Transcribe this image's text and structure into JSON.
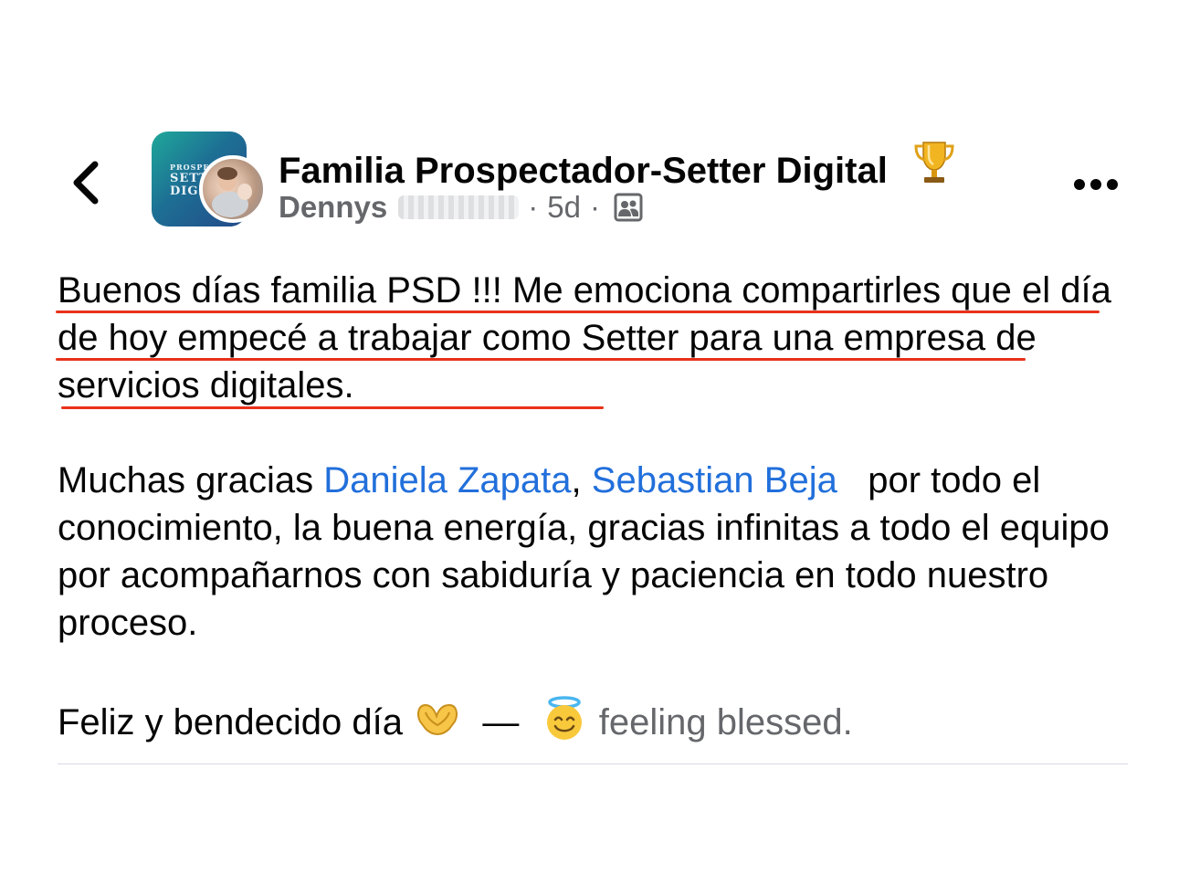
{
  "header": {
    "group_name": "Familia Prospectador-Setter Digital",
    "author_first_name": "Dennys",
    "time_ago": "5d",
    "separator": "·",
    "icons": {
      "back": "chevron-left-icon",
      "trophy": "trophy-icon",
      "audience": "group-audience-icon",
      "more": "more-options-icon"
    },
    "group_avatar_text": [
      "PROSPECTA",
      "SETTER",
      "DIGITAL"
    ]
  },
  "post": {
    "paragraph1": "Buenos días familia PSD !!! Me emociona compartirles que el día de hoy empecé a trabajar  como Setter para una empresa de servicios digitales.",
    "paragraph2": {
      "prefix": "Muchas gracias ",
      "mention1": "Daniela Zapata",
      "comma": ", ",
      "mention2": "Sebastian Beja",
      "suffix": "   por todo el conocimiento, la buena energía, gracias infinitas a todo el equipo por acompañarnos con sabiduría y paciencia en todo nuestro proceso."
    },
    "paragraph3": {
      "text": "Feliz y bendecido día",
      "dash": " — ",
      "feeling": "feeling blessed.",
      "emojis": [
        "heart-hands-emoji",
        "smiling-face-with-halo-emoji"
      ]
    }
  },
  "colors": {
    "mention": "#216fdb",
    "highlight_underline": "#e8321a",
    "meta_text": "#65676b"
  }
}
